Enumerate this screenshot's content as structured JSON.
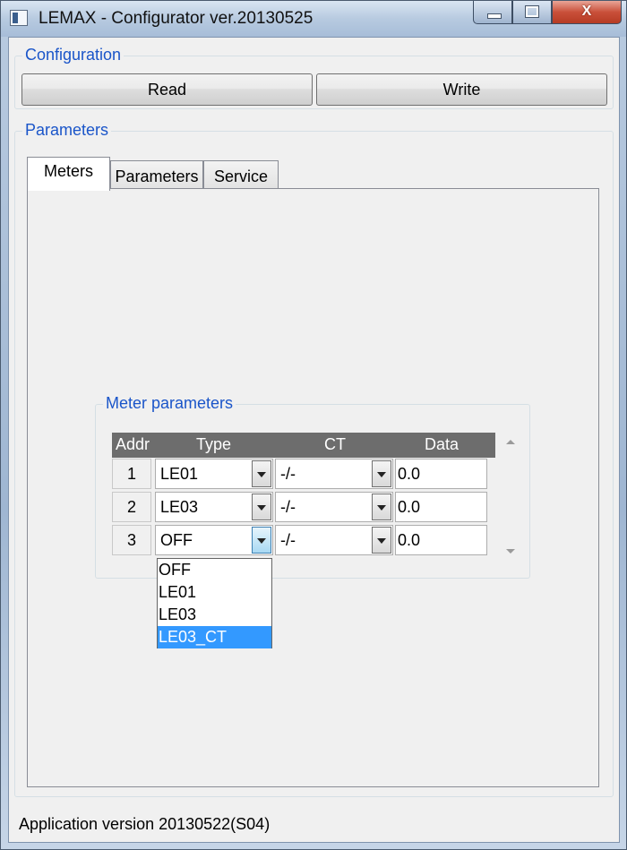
{
  "window": {
    "title": "LEMAX - Configurator ver.20130525",
    "min_glyph": "",
    "max_glyph": "",
    "close_glyph": "X"
  },
  "configuration": {
    "label": "Configuration",
    "read_label": "Read",
    "write_label": "Write"
  },
  "parameters_group": {
    "label": "Parameters",
    "tabs": [
      {
        "label": "Meters",
        "active": true
      },
      {
        "label": "Parameters",
        "active": false
      },
      {
        "label": "Service",
        "active": false
      }
    ]
  },
  "meter_parameters": {
    "label": "Meter parameters",
    "columns": [
      "Addr",
      "Type",
      "CT",
      "Data"
    ],
    "rows": [
      {
        "addr": "1",
        "type": "LE01",
        "ct": "-/-",
        "data": "0.0"
      },
      {
        "addr": "2",
        "type": "LE03",
        "ct": "-/-",
        "data": "0.0"
      },
      {
        "addr": "3",
        "type": "OFF",
        "ct": "-/-",
        "data": "0.0"
      }
    ]
  },
  "type_dropdown": {
    "options": [
      "OFF",
      "LE01",
      "LE03",
      "LE03_CT"
    ],
    "highlighted": "LE03_CT"
  },
  "status": {
    "text": "Application version 20130522(S04)"
  },
  "colors": {
    "group_label": "#1a55c9",
    "selection": "#3399ff",
    "grid_header": "#6d6d6d"
  }
}
